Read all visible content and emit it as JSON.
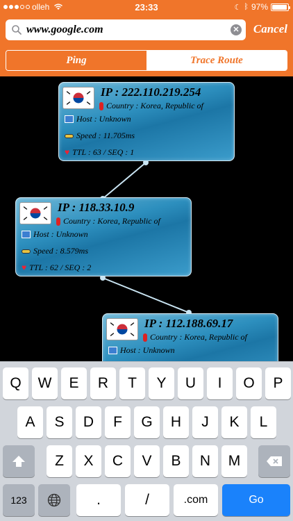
{
  "status": {
    "carrier": "olleh",
    "time": "23:33",
    "battery_percent": "97%",
    "battery_level": 0.97
  },
  "search": {
    "value": "www.google.com",
    "cancel_label": "Cancel"
  },
  "segments": [
    {
      "label": "Ping",
      "active": true
    },
    {
      "label": "Trace Route",
      "active": false
    }
  ],
  "nodes": [
    {
      "ip_label": "IP : 222.110.219.254",
      "country_label": "Country : Korea, Republic of",
      "host_label": "Host : Unknown",
      "speed_label": "Speed : 11.705ms",
      "ttl_label": "TTL : 63 / SEQ : 1"
    },
    {
      "ip_label": "IP : 118.33.10.9",
      "country_label": "Country : Korea, Republic of",
      "host_label": "Host : Unknown",
      "speed_label": "Speed : 8.579ms",
      "ttl_label": "TTL : 62 / SEQ : 2"
    },
    {
      "ip_label": "IP : 112.188.69.17",
      "country_label": "Country : Korea, Republic of",
      "host_label": "Host : Unknown",
      "speed_label": "",
      "ttl_label": ""
    }
  ],
  "keyboard": {
    "row1": [
      "Q",
      "W",
      "E",
      "R",
      "T",
      "Y",
      "U",
      "I",
      "O",
      "P"
    ],
    "row2": [
      "A",
      "S",
      "D",
      "F",
      "G",
      "H",
      "J",
      "K",
      "L"
    ],
    "row3": [
      "Z",
      "X",
      "C",
      "V",
      "B",
      "N",
      "M"
    ],
    "numbers_label": "123",
    "period_label": ".",
    "slash_label": "/",
    "com_label": ".com",
    "go_label": "Go"
  }
}
